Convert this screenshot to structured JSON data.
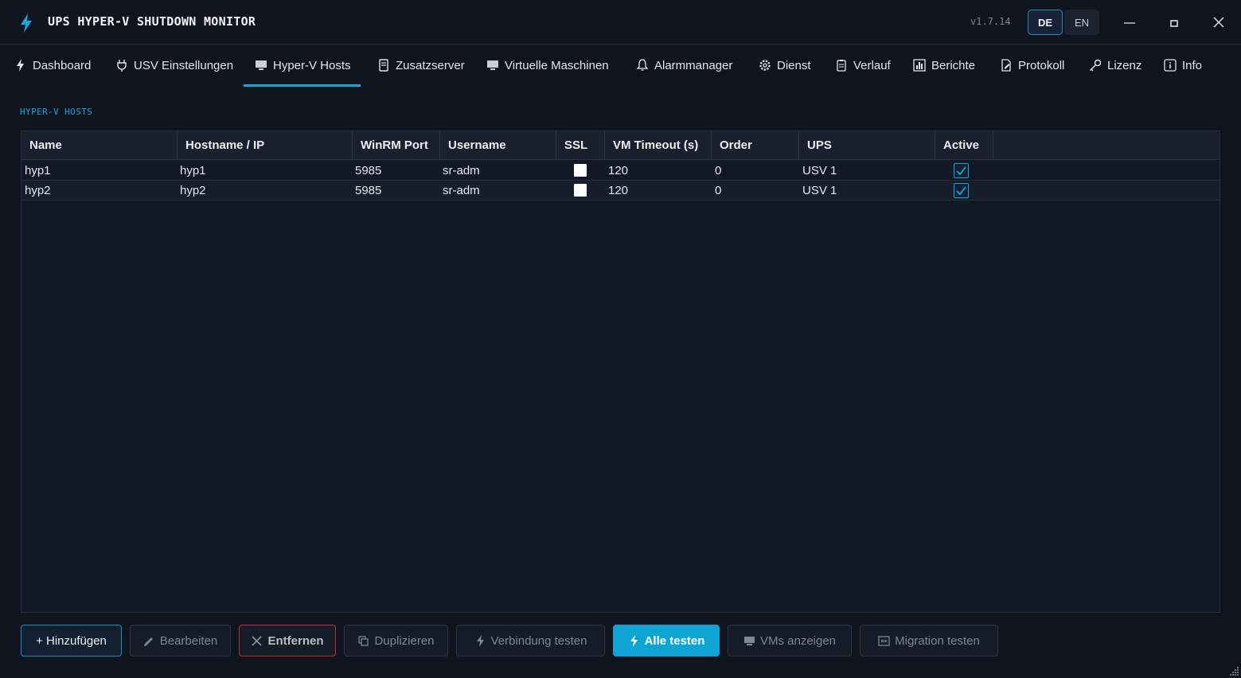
{
  "titlebar": {
    "title": "UPS HYPER-V SHUTDOWN MONITOR",
    "version": "v1.7.14",
    "languages": [
      {
        "code": "DE",
        "selected": true
      },
      {
        "code": "EN",
        "selected": false
      }
    ],
    "window_controls": [
      "minimize-icon",
      "maximize-icon",
      "close-icon"
    ]
  },
  "tabs": [
    {
      "label": "Dashboard",
      "icon": "bolt-icon"
    },
    {
      "label": "USV Einstellungen",
      "icon": "plug-icon"
    },
    {
      "label": "Hyper-V Hosts",
      "icon": "monitor-icon",
      "active": true
    },
    {
      "label": "Zusatzserver",
      "icon": "server-icon"
    },
    {
      "label": "Virtuelle Maschinen",
      "icon": "monitor-icon"
    },
    {
      "label": "Alarmmanager",
      "icon": "bell-icon"
    },
    {
      "label": "Dienst",
      "icon": "gear-icon"
    },
    {
      "label": "Verlauf",
      "icon": "clipboard-icon"
    },
    {
      "label": "Berichte",
      "icon": "bar-chart-icon"
    },
    {
      "label": "Protokoll",
      "icon": "edit-doc-icon"
    },
    {
      "label": "Lizenz",
      "icon": "key-icon"
    },
    {
      "label": "Info",
      "icon": "info-icon"
    }
  ],
  "section": {
    "label": "HYPER-V HOSTS"
  },
  "table": {
    "columns": [
      "Name",
      "Hostname / IP",
      "WinRM Port",
      "Username",
      "SSL",
      "VM Timeout (s)",
      "Order",
      "UPS",
      "Active"
    ],
    "rows": [
      {
        "name": "hyp1",
        "hostname": "hyp1",
        "port": "5985",
        "username": "sr-adm",
        "ssl": false,
        "timeout": "120",
        "order": "0",
        "ups": "USV 1",
        "active": true
      },
      {
        "name": "hyp2",
        "hostname": "hyp2",
        "port": "5985",
        "username": "sr-adm",
        "ssl": false,
        "timeout": "120",
        "order": "0",
        "ups": "USV 1",
        "active": true
      }
    ]
  },
  "actions": {
    "add": "+ Hinzufügen",
    "edit": "Bearbeiten",
    "remove": "Entfernen",
    "duplicate": "Duplizieren",
    "test_connection": "Verbindung testen",
    "test_all": "Alle testen",
    "show_vms": "VMs anzeigen",
    "test_migration": "Migration testen"
  },
  "colors": {
    "background": "#10141e",
    "accent": "#15a6d2",
    "danger": "#b3343a"
  }
}
